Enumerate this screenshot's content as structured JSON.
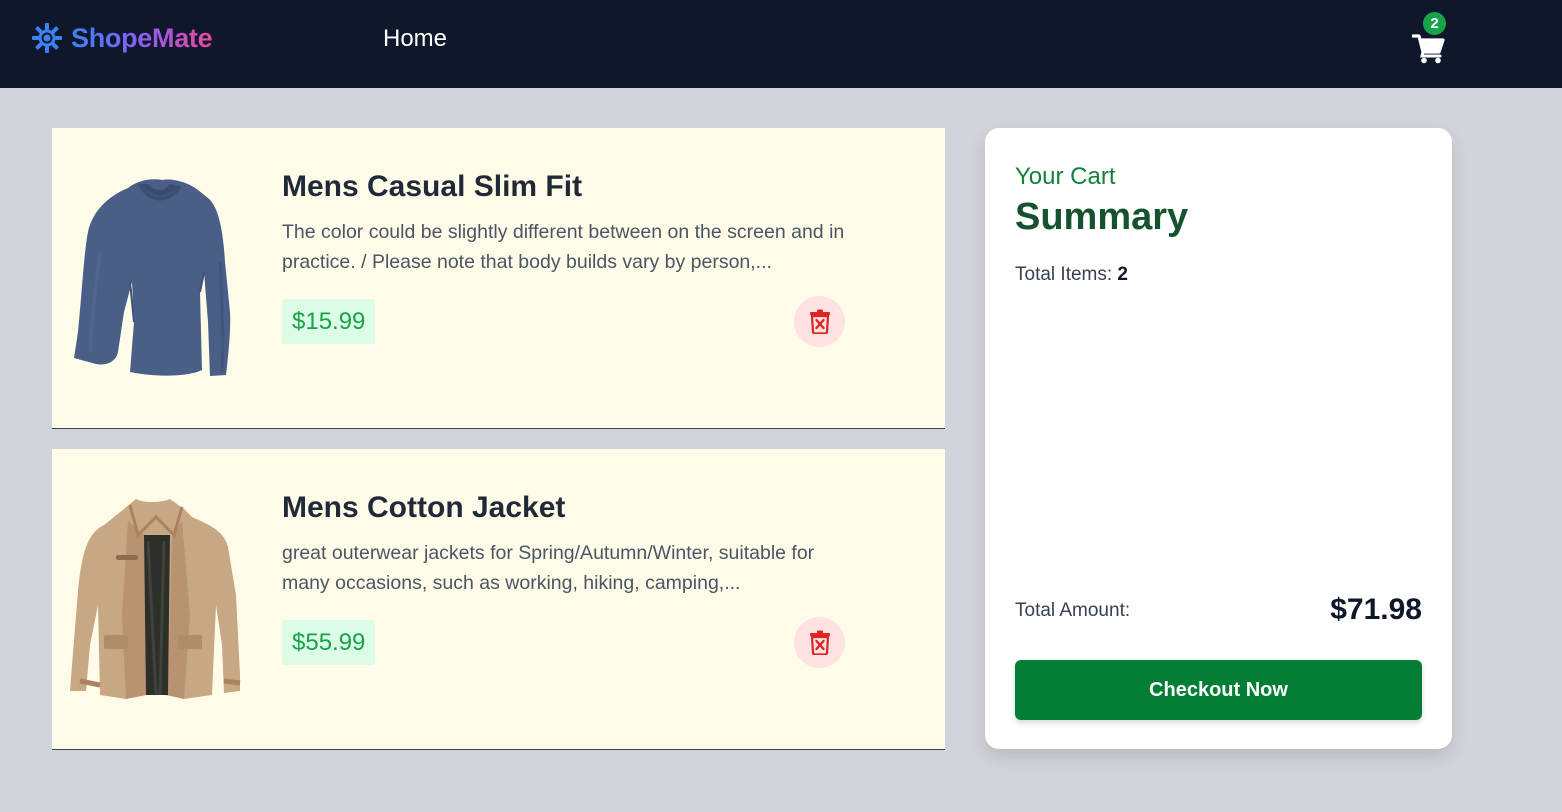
{
  "app": {
    "name": "ShopeMate",
    "logo_icon": "gear-icon",
    "colors": {
      "nav_bg": "#0f172a",
      "accent_green": "#16a34a",
      "checkout_green": "#047e34",
      "card_bg": "#fefce8",
      "delete_red": "#dc2626"
    }
  },
  "nav": {
    "links": [
      {
        "label": "Home"
      }
    ],
    "cart": {
      "icon": "cart-icon",
      "badge_count": "2"
    }
  },
  "cart_items": [
    {
      "title": "Mens Casual Slim Fit",
      "description": "The color could be slightly different between on the screen and in practice. / Please note that body builds vary by person,...",
      "price": "$15.99",
      "image": "long-sleeve-shirt-icon",
      "delete_icon": "trash-icon"
    },
    {
      "title": "Mens Cotton Jacket",
      "description": "great outerwear jackets for Spring/Autumn/Winter, suitable for many occasions, such as working, hiking, camping,...",
      "price": "$55.99",
      "image": "jacket-icon",
      "delete_icon": "trash-icon"
    }
  ],
  "summary": {
    "kicker": "Your Cart",
    "title": "Summary",
    "total_items_label": "Total Items:",
    "total_items_value": "2",
    "total_amount_label": "Total Amount:",
    "total_amount_value": "$71.98",
    "checkout_label": "Checkout Now"
  }
}
